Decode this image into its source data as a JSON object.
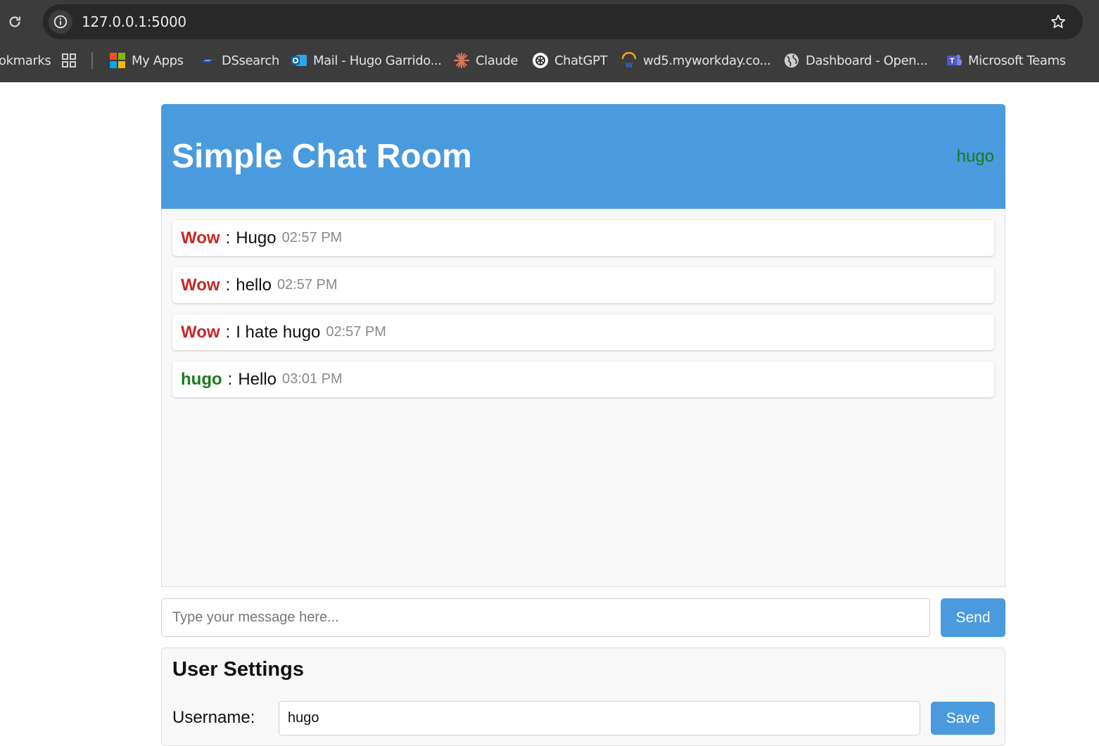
{
  "browser": {
    "url": "127.0.0.1:5000",
    "bookmarks": [
      {
        "label": "okmarks",
        "icon": "bookmarks-truncated"
      },
      {
        "label": "",
        "icon": "apps-grid-icon"
      },
      {
        "label": "My Apps",
        "icon": "microsoft-logo-icon"
      },
      {
        "label": "DSsearch",
        "icon": "dssearch-icon"
      },
      {
        "label": "Mail - Hugo Garrido...",
        "icon": "outlook-icon"
      },
      {
        "label": "Claude",
        "icon": "claude-icon"
      },
      {
        "label": "ChatGPT",
        "icon": "chatgpt-icon"
      },
      {
        "label": "wd5.myworkday.co...",
        "icon": "workday-icon"
      },
      {
        "label": "Dashboard - Open...",
        "icon": "globe-icon"
      },
      {
        "label": "Microsoft Teams",
        "icon": "teams-icon"
      }
    ]
  },
  "chat": {
    "title": "Simple Chat Room",
    "current_user": "hugo",
    "messages": [
      {
        "author": "Wow",
        "separator": ":",
        "text": "Hugo",
        "time": "02:57 PM",
        "author_color": "#c62828"
      },
      {
        "author": "Wow",
        "separator": ":",
        "text": "hello",
        "time": "02:57 PM",
        "author_color": "#c62828"
      },
      {
        "author": "Wow",
        "separator": ":",
        "text": "I hate hugo",
        "time": "02:57 PM",
        "author_color": "#c62828"
      },
      {
        "author": "hugo",
        "separator": ":",
        "text": "Hello",
        "time": "03:01 PM",
        "author_color": "#1a7a1a"
      }
    ],
    "input": {
      "placeholder": "Type your message here...",
      "value": ""
    },
    "send_label": "Send"
  },
  "settings": {
    "title": "User Settings",
    "username_label": "Username:",
    "username_value": "hugo",
    "save_label": "Save"
  },
  "colors": {
    "accent": "#4a9ade",
    "other_user": "#c62828",
    "self_user": "#1a7a1a"
  }
}
